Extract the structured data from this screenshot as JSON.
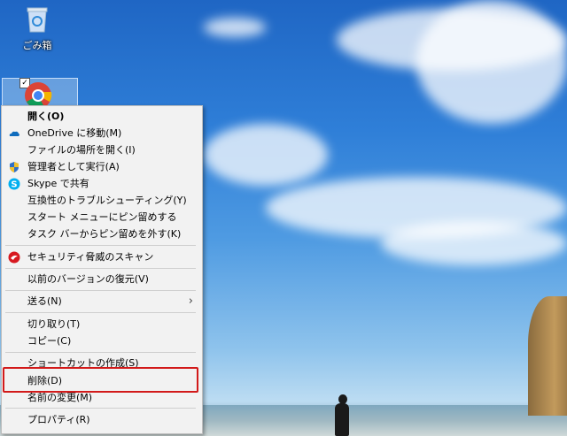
{
  "desktop": {
    "recycle_bin_label": "ごみ箱"
  },
  "context_menu": {
    "items": [
      {
        "label": "開く(O)",
        "bold": true
      },
      {
        "label": "OneDrive に移動(M)",
        "icon": "onedrive-icon"
      },
      {
        "label": "ファイルの場所を開く(I)"
      },
      {
        "label": "管理者として実行(A)",
        "icon": "shield-icon"
      },
      {
        "label": "Skype で共有",
        "icon": "skype-icon"
      },
      {
        "label": "互換性のトラブルシューティング(Y)"
      },
      {
        "label": "スタート メニューにピン留めする"
      },
      {
        "label": "タスク バーからピン留めを外す(K)"
      },
      {
        "label": "セキュリティ脅威のスキャン",
        "icon": "trend-micro-icon"
      },
      {
        "label": "以前のバージョンの復元(V)"
      },
      {
        "label": "送る(N)",
        "submenu": true
      },
      {
        "label": "切り取り(T)"
      },
      {
        "label": "コピー(C)"
      },
      {
        "label": "ショートカットの作成(S)"
      },
      {
        "label": "削除(D)",
        "highlighted": true
      },
      {
        "label": "名前の変更(M)"
      },
      {
        "label": "プロパティ(R)"
      }
    ],
    "highlight_color": "#d21a1a"
  }
}
